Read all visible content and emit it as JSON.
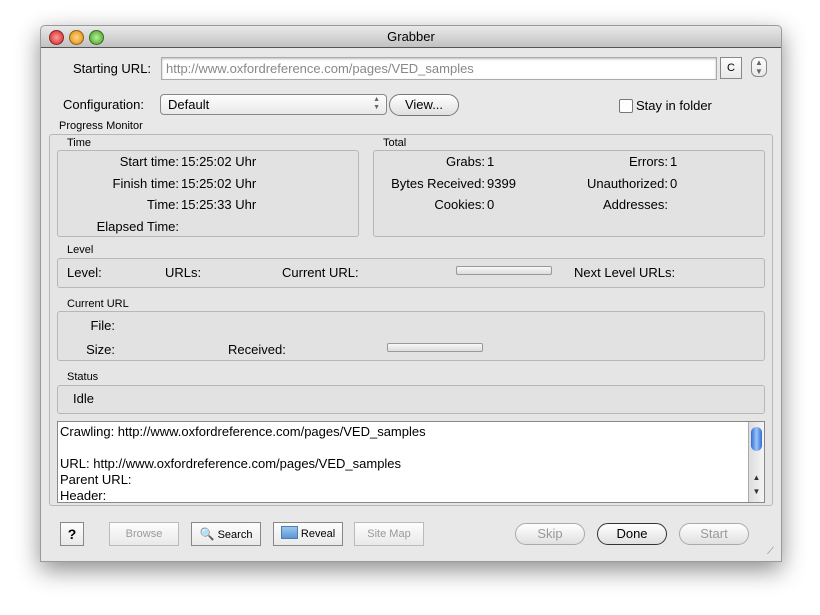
{
  "window": {
    "title": "Grabber"
  },
  "starting_url": {
    "label": "Starting URL:",
    "value": "http://www.oxfordreference.com/pages/VED_samples",
    "c_button": "C"
  },
  "configuration": {
    "label": "Configuration:",
    "value": "Default",
    "view_button": "View...",
    "stay_label": "Stay in folder",
    "stay_checked": false
  },
  "progress": {
    "title": "Progress Monitor",
    "time": {
      "title": "Time",
      "start_label": "Start time:",
      "start": "15:25:02 Uhr",
      "finish_label": "Finish time:",
      "finish": "15:25:02 Uhr",
      "time_label": "Time:",
      "time": "15:25:33 Uhr",
      "elapsed_label": "Elapsed Time:"
    },
    "total": {
      "title": "Total",
      "grabs_label": "Grabs:",
      "grabs": "1",
      "bytes_label": "Bytes Received:",
      "bytes": "9399",
      "cookies_label": "Cookies:",
      "cookies": "0",
      "errors_label": "Errors:",
      "errors": "1",
      "unauth_label": "Unauthorized:",
      "unauth": "0",
      "addresses_label": "Addresses:"
    },
    "level": {
      "title": "Level",
      "level_label": "Level:",
      "urls_label": "URLs:",
      "current_label": "Current URL:",
      "next_label": "Next Level URLs:",
      "progress": 0
    },
    "current": {
      "title": "Current URL",
      "file_label": "File:",
      "size_label": "Size:",
      "received_label": "Received:",
      "progress": 0
    },
    "status": {
      "title": "Status",
      "value": "Idle"
    }
  },
  "log": [
    "Crawling: http://www.oxfordreference.com/pages/VED_samples",
    "",
    "URL: http://www.oxfordreference.com/pages/VED_samples",
    "Parent URL:",
    "Header:"
  ],
  "buttons": {
    "help": "?",
    "browse": "Browse",
    "search": "Search",
    "reveal": "Reveal",
    "sitemap": "Site Map",
    "skip": "Skip",
    "done": "Done",
    "start": "Start"
  }
}
